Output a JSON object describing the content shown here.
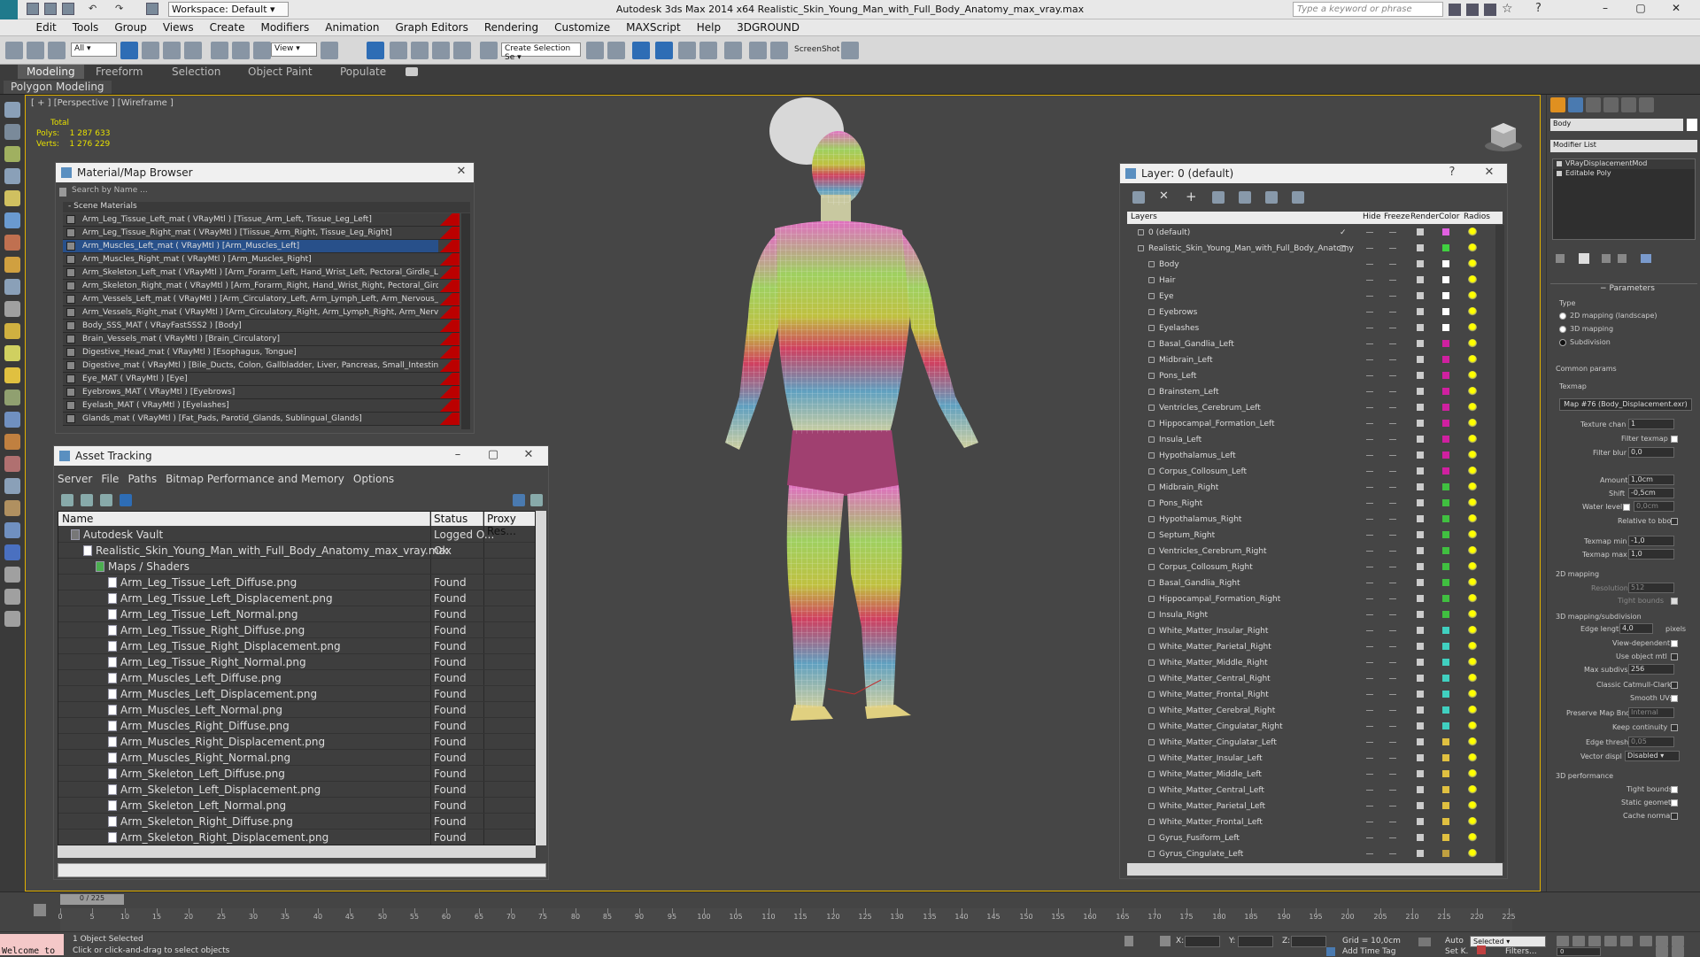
{
  "window": {
    "title": "Autodesk 3ds Max  2014 x64     Realistic_Skin_Young_Man_with_Full_Body_Anatomy_max_vray.max",
    "workspace": "Workspace: Default",
    "search_placeholder": "Type a keyword or phrase"
  },
  "menu": [
    "Edit",
    "Tools",
    "Group",
    "Views",
    "Create",
    "Modifiers",
    "Animation",
    "Graph Editors",
    "Rendering",
    "Customize",
    "MAXScript",
    "Help",
    "3DGROUND"
  ],
  "toolbar": {
    "filter": "All",
    "refcoord": "View",
    "selset": "Create Selection Se",
    "screenshot": "ScreenShot"
  },
  "ribbon": {
    "tabs": [
      "Modeling",
      "Freeform",
      "Selection",
      "Object Paint",
      "Populate"
    ],
    "active": "Modeling",
    "sub": "Polygon Modeling"
  },
  "viewport": {
    "label": "[ + ] [Perspective ] [Wireframe ]",
    "stats_total": "Total",
    "polys_label": "Polys:",
    "polys_value": "1 287 633",
    "verts_label": "Verts:",
    "verts_value": "1 276 229"
  },
  "material_browser": {
    "title": "Material/Map Browser",
    "search": "Search by Name ...",
    "group": "- Scene Materials",
    "items": [
      "Arm_Leg_Tissue_Left_mat  ( VRayMtl ) [Tissue_Arm_Left, Tissue_Leg_Left]",
      "Arm_Leg_Tissue_Right_mat  ( VRayMtl ) [Tiissue_Arm_Right, Tissue_Leg_Right]",
      "Arm_Muscles_Left_mat  ( VRayMtl ) [Arm_Muscles_Left]",
      "Arm_Muscles_Right_mat  ( VRayMtl ) [Arm_Muscles_Right]",
      "Arm_Skeleton_Left_mat  ( VRayMtl ) [Arm_Forarm_Left, Hand_Wrist_Left, Pectoral_Girdle_Left]",
      "Arm_Skeleton_Right_mat  ( VRayMtl ) [Arm_Forarm_Right, Hand_Wrist_Right, Pectoral_Girdle_Right]",
      "Arm_Vessels_Left_mat  ( VRayMtl ) [Arm_Circulatory_Left, Arm_Lymph_Left, Arm_Nervous_Left]",
      "Arm_Vessels_Right_mat  ( VRayMtl ) [Arm_Circulatory_Right, Arm_Lymph_Right, Arm_Nervous_Right]",
      "Body_SSS_MAT  ( VRayFastSSS2 ) [Body]",
      "Brain_Vessels_mat  ( VRayMtl ) [Brain_Circulatory]",
      "Digestive_Head_mat  ( VRayMtl ) [Esophagus, Tongue]",
      "Digestive_mat  ( VRayMtl ) [Bile_Ducts, Colon, Gallbladder, Liver, Pancreas, Small_Intestines, Stomach]",
      "Eye_MAT  ( VRayMtl ) [Eye]",
      "Eyebrows_MAT  ( VRayMtl ) [Eyebrows]",
      "Eyelash_MAT  ( VRayMtl ) [Eyelashes]",
      "Glands_mat  ( VRayMtl ) [Fat_Pads, Parotid_Glands, Sublingual_Glands]"
    ],
    "selected_index": 2
  },
  "asset_tracking": {
    "title": "Asset Tracking",
    "menu": [
      "Server",
      "File",
      "Paths",
      "Bitmap Performance and Memory",
      "Options"
    ],
    "columns": [
      "Name",
      "Status",
      "Proxy Res..."
    ],
    "rows": [
      {
        "name": "Autodesk Vault",
        "status": "Logged O...",
        "level": 0
      },
      {
        "name": "Realistic_Skin_Young_Man_with_Full_Body_Anatomy_max_vray.max",
        "status": "Ok",
        "level": 1
      },
      {
        "name": "Maps / Shaders",
        "status": "",
        "level": 2
      },
      {
        "name": "Arm_Leg_Tissue_Left_Diffuse.png",
        "status": "Found",
        "level": 3
      },
      {
        "name": "Arm_Leg_Tissue_Left_Displacement.png",
        "status": "Found",
        "level": 3
      },
      {
        "name": "Arm_Leg_Tissue_Left_Normal.png",
        "status": "Found",
        "level": 3
      },
      {
        "name": "Arm_Leg_Tissue_Right_Diffuse.png",
        "status": "Found",
        "level": 3
      },
      {
        "name": "Arm_Leg_Tissue_Right_Displacement.png",
        "status": "Found",
        "level": 3
      },
      {
        "name": "Arm_Leg_Tissue_Right_Normal.png",
        "status": "Found",
        "level": 3
      },
      {
        "name": "Arm_Muscles_Left_Diffuse.png",
        "status": "Found",
        "level": 3
      },
      {
        "name": "Arm_Muscles_Left_Displacement.png",
        "status": "Found",
        "level": 3
      },
      {
        "name": "Arm_Muscles_Left_Normal.png",
        "status": "Found",
        "level": 3
      },
      {
        "name": "Arm_Muscles_Right_Diffuse.png",
        "status": "Found",
        "level": 3
      },
      {
        "name": "Arm_Muscles_Right_Displacement.png",
        "status": "Found",
        "level": 3
      },
      {
        "name": "Arm_Muscles_Right_Normal.png",
        "status": "Found",
        "level": 3
      },
      {
        "name": "Arm_Skeleton_Left_Diffuse.png",
        "status": "Found",
        "level": 3
      },
      {
        "name": "Arm_Skeleton_Left_Displacement.png",
        "status": "Found",
        "level": 3
      },
      {
        "name": "Arm_Skeleton_Left_Normal.png",
        "status": "Found",
        "level": 3
      },
      {
        "name": "Arm_Skeleton_Right_Diffuse.png",
        "status": "Found",
        "level": 3
      },
      {
        "name": "Arm_Skeleton_Right_Displacement.png",
        "status": "Found",
        "level": 3
      }
    ]
  },
  "layers": {
    "title": "Layer: 0 (default)",
    "columns": [
      "Layers",
      "Hide",
      "Freeze",
      "Render",
      "Color",
      "Radios"
    ],
    "items": [
      {
        "name": "0 (default)",
        "level": 0,
        "color": "#e060e0",
        "check": true
      },
      {
        "name": "Realistic_Skin_Young_Man_with_Full_Body_Anatomy",
        "level": 0,
        "color": "#40d040",
        "box": true
      },
      {
        "name": "Body",
        "level": 1,
        "color": "#ffffff"
      },
      {
        "name": "Hair",
        "level": 1,
        "color": "#ffffff"
      },
      {
        "name": "Eye",
        "level": 1,
        "color": "#ffffff"
      },
      {
        "name": "Eyebrows",
        "level": 1,
        "color": "#ffffff"
      },
      {
        "name": "Eyelashes",
        "level": 1,
        "color": "#ffffff"
      },
      {
        "name": "Basal_Gandlia_Left",
        "level": 1,
        "color": "#d020a0"
      },
      {
        "name": "Midbrain_Left",
        "level": 1,
        "color": "#d020a0"
      },
      {
        "name": "Pons_Left",
        "level": 1,
        "color": "#d020a0"
      },
      {
        "name": "Brainstem_Left",
        "level": 1,
        "color": "#d020a0"
      },
      {
        "name": "Ventricles_Cerebrum_Left",
        "level": 1,
        "color": "#d020a0"
      },
      {
        "name": "Hippocampal_Formation_Left",
        "level": 1,
        "color": "#d020a0"
      },
      {
        "name": "Insula_Left",
        "level": 1,
        "color": "#d020a0"
      },
      {
        "name": "Hypothalamus_Left",
        "level": 1,
        "color": "#d020a0"
      },
      {
        "name": "Corpus_Collosum_Left",
        "level": 1,
        "color": "#d020a0"
      },
      {
        "name": "Midbrain_Right",
        "level": 1,
        "color": "#40c040"
      },
      {
        "name": "Pons_Right",
        "level": 1,
        "color": "#40c040"
      },
      {
        "name": "Hypothalamus_Right",
        "level": 1,
        "color": "#40c040"
      },
      {
        "name": "Septum_Right",
        "level": 1,
        "color": "#40c040"
      },
      {
        "name": "Ventricles_Cerebrum_Right",
        "level": 1,
        "color": "#40c040"
      },
      {
        "name": "Corpus_Collosum_Right",
        "level": 1,
        "color": "#40c040"
      },
      {
        "name": "Basal_Gandlia_Right",
        "level": 1,
        "color": "#40c040"
      },
      {
        "name": "Hippocampal_Formation_Right",
        "level": 1,
        "color": "#40c040"
      },
      {
        "name": "Insula_Right",
        "level": 1,
        "color": "#40c040"
      },
      {
        "name": "White_Matter_Insular_Right",
        "level": 1,
        "color": "#40d0c0"
      },
      {
        "name": "White_Matter_Parietal_Right",
        "level": 1,
        "color": "#40d0c0"
      },
      {
        "name": "White_Matter_Middle_Right",
        "level": 1,
        "color": "#40d0c0"
      },
      {
        "name": "White_Matter_Central_Right",
        "level": 1,
        "color": "#40d0c0"
      },
      {
        "name": "White_Matter_Frontal_Right",
        "level": 1,
        "color": "#40d0c0"
      },
      {
        "name": "White_Matter_Cerebral_Right",
        "level": 1,
        "color": "#40d0c0"
      },
      {
        "name": "White_Matter_Cingulatar_Right",
        "level": 1,
        "color": "#40d0c0"
      },
      {
        "name": "White_Matter_Cingulatar_Left",
        "level": 1,
        "color": "#e0c040"
      },
      {
        "name": "White_Matter_Insular_Left",
        "level": 1,
        "color": "#e0c040"
      },
      {
        "name": "White_Matter_Middle_Left",
        "level": 1,
        "color": "#e0c040"
      },
      {
        "name": "White_Matter_Central_Left",
        "level": 1,
        "color": "#e0c040"
      },
      {
        "name": "White_Matter_Parietal_Left",
        "level": 1,
        "color": "#e0c040"
      },
      {
        "name": "White_Matter_Frontal_Left",
        "level": 1,
        "color": "#e0c040"
      },
      {
        "name": "Gyrus_Fusiform_Left",
        "level": 1,
        "color": "#e0c040"
      },
      {
        "name": "Gyrus_Cingulate_Left",
        "level": 1,
        "color": "#c0a040"
      }
    ]
  },
  "command_panel": {
    "object_name": "Body",
    "modifier_list": "Modifier List",
    "stack": [
      "VRayDisplacementMod",
      "Editable Poly"
    ],
    "params_title": "Parameters",
    "type_label": "Type",
    "types": [
      "2D mapping (landscape)",
      "3D mapping",
      "Subdivision"
    ],
    "type_selected": 2,
    "common_params": "Common params",
    "texmap_label": "Texmap",
    "texmap_value": "Map #76 (Body_Displacement.exr)",
    "texture_chan_label": "Texture chan",
    "texture_chan": "1",
    "filter_texmap": "Filter texmap",
    "filter_blur_label": "Filter blur",
    "filter_blur": "0,0",
    "amount_label": "Amount",
    "amount": "1,0cm",
    "shift_label": "Shift",
    "shift": "-0,5cm",
    "water_label": "Water level",
    "water": "0,0cm",
    "relative_bbox": "Relative to bbox",
    "texmap_min_label": "Texmap min",
    "texmap_min": "-1,0",
    "texmap_max_label": "Texmap max",
    "texmap_max": "1,0",
    "mapping2d": "2D mapping",
    "resolution_label": "Resolution",
    "resolution": "512",
    "tight_bounds": "Tight bounds",
    "mapping3d": "3D mapping/subdivision",
    "edge_length_label": "Edge length",
    "edge_length": "4,0",
    "pixels": "pixels",
    "view_dependent": "View-dependent",
    "use_object_mtl": "Use object mtl",
    "max_subdivs_label": "Max subdivs",
    "max_subdivs": "256",
    "catmull": "Classic Catmull-Clark",
    "smooth_uvs": "Smooth UVs",
    "preserve_label": "Preserve Map Bnd",
    "preserve": "Internal",
    "keep_continuity": "Keep continuity",
    "edge_thresh_label": "Edge thresh",
    "edge_thresh": "0,05",
    "vector_disp_label": "Vector displ",
    "vector_disp": "Disabled",
    "perf": "3D performance",
    "perf_tight": "Tight bounds",
    "static_geometry": "Static geometry",
    "cache_normals": "Cache normals"
  },
  "timeline": {
    "frame": "0 / 225",
    "ticks": [
      "0",
      "5",
      "10",
      "15",
      "20",
      "25",
      "30",
      "35",
      "40",
      "45",
      "50",
      "55",
      "60",
      "65",
      "70",
      "75",
      "80",
      "85",
      "90",
      "95",
      "100",
      "105",
      "110",
      "115",
      "120",
      "125",
      "130",
      "135",
      "140",
      "145",
      "150",
      "155",
      "160",
      "165",
      "170",
      "175",
      "180",
      "185",
      "190",
      "195",
      "200",
      "205",
      "210",
      "215",
      "220",
      "225"
    ]
  },
  "status": {
    "welcome": "Welcome to",
    "selected": "1 Object Selected",
    "hint": "Click or click-and-drag to select objects",
    "x": "X:",
    "y": "Y:",
    "z": "Z:",
    "grid": "Grid = 10,0cm",
    "add_time_tag": "Add Time Tag",
    "auto": "Auto",
    "selected_mode": "Selected",
    "set_key": "Set K.",
    "filters": "Filters...",
    "frame_field": "0"
  },
  "colors": {
    "accent": "#e0b000",
    "selection": "#28508a",
    "viewport_bg": "#464646",
    "stats": "#e8e000"
  }
}
